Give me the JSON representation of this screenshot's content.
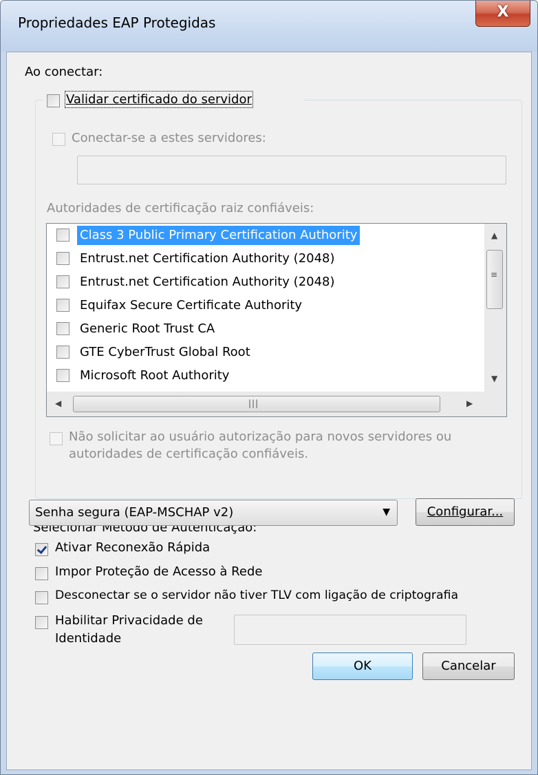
{
  "window": {
    "title": "Propriedades EAP Protegidas",
    "close_glyph": "X"
  },
  "connect": {
    "heading": "Ao conectar:",
    "validate_cert": {
      "label": "Validar certificado do servidor",
      "checked": false
    },
    "connect_servers": {
      "label": "Conectar-se a estes servidores:",
      "checked": false,
      "value": ""
    },
    "trusted_roots_label": "Autoridades de certificação raiz confiáveis:",
    "authorities": [
      {
        "label": "Class 3 Public Primary Certification Authority",
        "checked": false,
        "selected": true
      },
      {
        "label": "Entrust.net Certification Authority (2048)",
        "checked": false,
        "selected": false
      },
      {
        "label": "Entrust.net Certification Authority (2048)",
        "checked": false,
        "selected": false
      },
      {
        "label": "Equifax Secure Certificate Authority",
        "checked": false,
        "selected": false
      },
      {
        "label": "Generic Root Trust CA",
        "checked": false,
        "selected": false
      },
      {
        "label": "GTE CyberTrust Global Root",
        "checked": false,
        "selected": false
      },
      {
        "label": "Microsoft Root Authority",
        "checked": false,
        "selected": false
      }
    ],
    "no_prompt": {
      "line1": "Não solicitar ao usuário autorização para novos servidores ou",
      "line2": "autoridades de certificação confiáveis.",
      "checked": false
    }
  },
  "auth": {
    "heading": "Selecionar Método de Autenticação:",
    "method": "Senha segura (EAP-MSCHAP v2)",
    "configure_label": "Configurar..."
  },
  "options": {
    "fast_reconnect": {
      "label": "Ativar Reconexão Rápida",
      "checked": true
    },
    "nap": {
      "label": "Impor Proteção de Acesso à Rede",
      "checked": false
    },
    "tlv": {
      "label": "Desconectar se o servidor não tiver TLV com ligação de criptografia",
      "checked": false
    },
    "privacy": {
      "line1": "Habilitar Privacidade de",
      "line2": "Identidade",
      "checked": false,
      "value": ""
    }
  },
  "buttons": {
    "ok": "OK",
    "cancel": "Cancelar"
  },
  "icons": {
    "close": "close-icon",
    "scroll_up": "up-arrow-icon",
    "scroll_down": "down-arrow-icon",
    "scroll_left": "left-arrow-icon",
    "scroll_right": "right-arrow-icon",
    "dropdown": "chevron-down-icon"
  }
}
